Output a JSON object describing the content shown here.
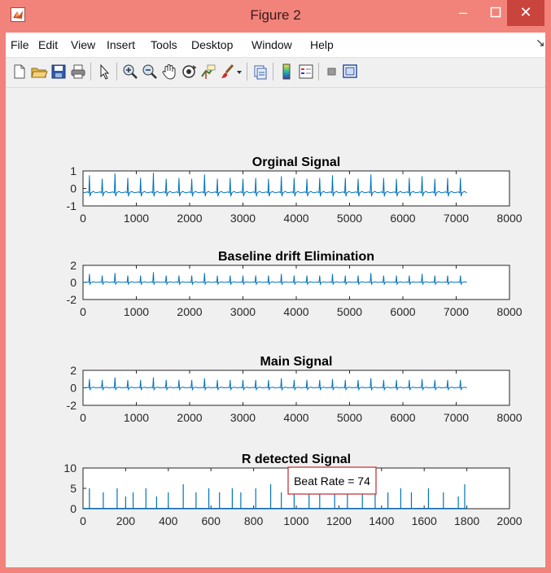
{
  "window": {
    "title": "Figure 2",
    "accent": "#f1837a",
    "close_color": "#c9443c"
  },
  "menubar": {
    "items": [
      "File",
      "Edit",
      "View",
      "Insert",
      "Tools",
      "Desktop",
      "Window",
      "Help"
    ]
  },
  "toolbar": {
    "icons": [
      "new-figure-icon",
      "open-file-icon",
      "save-icon",
      "print-icon",
      "edit-plot-arrow-icon",
      "zoom-in-icon",
      "zoom-out-icon",
      "pan-hand-icon",
      "rotate-3d-icon",
      "data-cursor-icon",
      "brush-icon",
      "brush-dropdown-icon",
      "link-plot-icon",
      "colorbar-icon",
      "legend-icon",
      "hide-plot-tools-icon",
      "show-plot-tools-icon"
    ]
  },
  "chart_data": [
    {
      "type": "line",
      "title": "Orginal Signal",
      "xlim": [
        0,
        8000
      ],
      "ylim": [
        -1,
        1
      ],
      "xticks": [
        0,
        1000,
        2000,
        3000,
        4000,
        5000,
        6000,
        7000,
        8000
      ],
      "yticks": [
        1,
        0,
        -1
      ],
      "series": [
        {
          "color": "#0072bd",
          "x_end": 7200,
          "baseline": -0.25,
          "peaks": [
            0.75,
            0.55,
            0.85,
            0.6,
            0.6,
            0.9,
            0.55,
            0.6,
            0.55,
            0.8,
            0.55,
            0.6,
            0.55,
            0.6,
            0.55,
            0.7,
            0.6,
            0.55,
            0.6,
            0.75,
            0.6,
            0.55,
            0.8,
            0.6,
            0.55,
            0.6,
            0.7,
            0.55,
            0.6,
            0.6
          ]
        }
      ]
    },
    {
      "type": "line",
      "title": "Baseline drift Elimination",
      "xlim": [
        0,
        8000
      ],
      "ylim": [
        -2,
        2
      ],
      "xticks": [
        0,
        1000,
        2000,
        3000,
        4000,
        5000,
        6000,
        7000,
        8000
      ],
      "yticks": [
        2,
        0,
        -2
      ],
      "series": [
        {
          "color": "#0072bd",
          "x_end": 7200,
          "baseline": 0,
          "peaks": [
            1.0,
            0.8,
            1.1,
            0.8,
            0.8,
            1.2,
            0.8,
            0.8,
            0.8,
            1.1,
            0.8,
            0.8,
            0.8,
            0.8,
            0.8,
            1.0,
            0.8,
            0.8,
            0.8,
            1.0,
            0.8,
            0.8,
            1.1,
            0.8,
            0.8,
            0.8,
            1.0,
            0.8,
            0.8,
            0.8
          ]
        }
      ]
    },
    {
      "type": "line",
      "title": "Main Signal",
      "xlim": [
        0,
        8000
      ],
      "ylim": [
        -2,
        2
      ],
      "xticks": [
        0,
        1000,
        2000,
        3000,
        4000,
        5000,
        6000,
        7000,
        8000
      ],
      "yticks": [
        2,
        0,
        -2
      ],
      "series": [
        {
          "color": "#0072bd",
          "x_end": 7200,
          "baseline": 0,
          "peaks": [
            1.0,
            0.9,
            1.2,
            0.9,
            0.9,
            1.2,
            0.9,
            0.9,
            0.9,
            1.1,
            0.9,
            0.9,
            0.9,
            0.9,
            0.9,
            1.1,
            0.9,
            0.9,
            0.9,
            1.0,
            0.9,
            0.9,
            1.1,
            0.9,
            0.9,
            0.9,
            1.0,
            0.9,
            0.9,
            0.9
          ]
        }
      ]
    },
    {
      "type": "bar",
      "title": "R detected Signal",
      "xlim": [
        0,
        2000
      ],
      "ylim": [
        0,
        10
      ],
      "xticks": [
        0,
        200,
        400,
        600,
        800,
        1000,
        1200,
        1400,
        1600,
        1800,
        2000
      ],
      "yticks": [
        10,
        5,
        0
      ],
      "annotation": "Beat Rate = 74",
      "annotation_color": "#c0282d",
      "series": [
        {
          "color": "#0072bd",
          "x": [
            30,
            95,
            160,
            200,
            235,
            295,
            345,
            400,
            470,
            530,
            590,
            640,
            700,
            740,
            810,
            880,
            930,
            990,
            1060,
            1110,
            1180,
            1240,
            1310,
            1370,
            1430,
            1490,
            1540,
            1620,
            1690,
            1760,
            1790
          ],
          "values": [
            5,
            4,
            5,
            3,
            4,
            5,
            3,
            4,
            6,
            4,
            5,
            4,
            5,
            4,
            5,
            6,
            4,
            5,
            6,
            4,
            5,
            4,
            5,
            6,
            4,
            5,
            4,
            5,
            4,
            3,
            6
          ]
        }
      ]
    }
  ]
}
